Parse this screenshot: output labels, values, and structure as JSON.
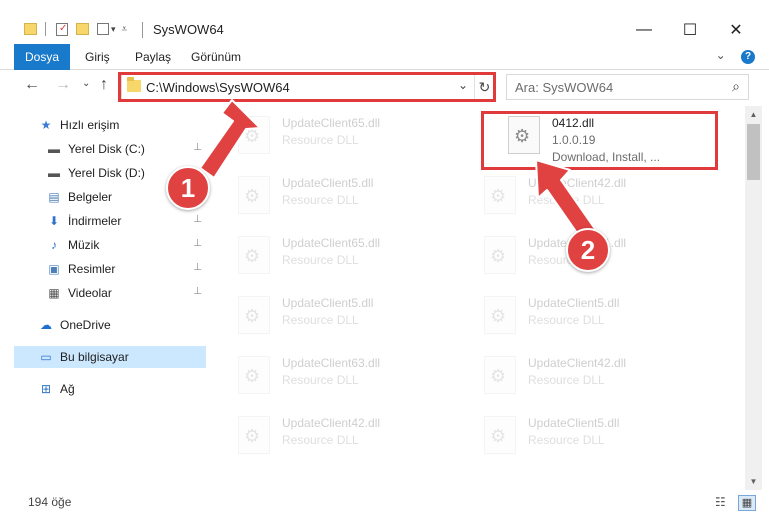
{
  "window": {
    "title": "SysWOW64",
    "minimize": "—",
    "maximize": "☐",
    "close": "✕"
  },
  "ribbon": {
    "tabs": [
      "Dosya",
      "Giriş",
      "Paylaş",
      "Görünüm"
    ],
    "toggle": "⌄",
    "help": "?"
  },
  "nav": {
    "back": "←",
    "forward": "→",
    "recent": "⌄",
    "up": "↑",
    "address": "C:\\Windows\\SysWOW64",
    "dropdown": "⌄",
    "refresh": "↻",
    "search_placeholder": "Ara: SysWOW64",
    "search_icon": "⌕"
  },
  "sidebar": {
    "items": [
      {
        "label": "Hızlı erişim",
        "icon": "star-icon",
        "glyph": "★",
        "color": "#3c7bd6",
        "pinned": false
      },
      {
        "label": "Yerel Disk (C:)",
        "icon": "drive-icon",
        "glyph": "▬",
        "color": "#555555",
        "pinned": true
      },
      {
        "label": "Yerel Disk (D:)",
        "icon": "drive-icon",
        "glyph": "▬",
        "color": "#555555",
        "pinned": false
      },
      {
        "label": "Belgeler",
        "icon": "documents-icon",
        "glyph": "▤",
        "color": "#4d7fb8",
        "pinned": true
      },
      {
        "label": "İndirmeler",
        "icon": "download-icon",
        "glyph": "⬇",
        "color": "#2f74c9",
        "pinned": true
      },
      {
        "label": "Müzik",
        "icon": "music-icon",
        "glyph": "♪",
        "color": "#2f74c9",
        "pinned": true
      },
      {
        "label": "Resimler",
        "icon": "pictures-icon",
        "glyph": "▣",
        "color": "#4d7fb8",
        "pinned": true
      },
      {
        "label": "Videolar",
        "icon": "videos-icon",
        "glyph": "▦",
        "color": "#555555",
        "pinned": true
      },
      {
        "label": "OneDrive",
        "icon": "cloud-icon",
        "glyph": "☁",
        "color": "#1f6fd1",
        "pinned": false
      },
      {
        "label": "Bu bilgisayar",
        "icon": "computer-icon",
        "glyph": "▭",
        "color": "#2f74c9",
        "pinned": false
      },
      {
        "label": "Ağ",
        "icon": "network-icon",
        "glyph": "⊞",
        "color": "#2f74c9",
        "pinned": false
      }
    ],
    "pin_glyph": "📌"
  },
  "files": {
    "highlighted": {
      "name": "0412.dll",
      "version": "1.0.0.19",
      "description": "Download, Install, ..."
    },
    "rows": [
      [
        {
          "name": "UpdateClient65.dll",
          "type": "Resource DLL"
        }
      ],
      [
        {
          "name": "UpdateClient5.dll",
          "type": "Resource DLL"
        },
        {
          "name": "UpdateClient42.dll",
          "type": "Resource DLL"
        }
      ],
      [
        {
          "name": "UpdateClient65.dll",
          "type": "Resource DLL"
        },
        {
          "name": "UpdateClient21.dll",
          "type": "Resource DLL"
        }
      ],
      [
        {
          "name": "UpdateClient5.dll",
          "type": "Resource DLL"
        },
        {
          "name": "UpdateClient5.dll",
          "type": "Resource DLL"
        }
      ],
      [
        {
          "name": "UpdateClient63.dll",
          "type": "Resource DLL"
        },
        {
          "name": "UpdateClient42.dll",
          "type": "Resource DLL"
        }
      ],
      [
        {
          "name": "UpdateClient42.dll",
          "type": "Resource DLL"
        },
        {
          "name": "UpdateClient5.dll",
          "type": "Resource DLL"
        }
      ]
    ],
    "gear": "⚙"
  },
  "callouts": {
    "one": "1",
    "two": "2",
    "color": "#e04141"
  },
  "status": {
    "count": "194 öğe",
    "details_view": "☷",
    "tiles_view": "▦"
  }
}
